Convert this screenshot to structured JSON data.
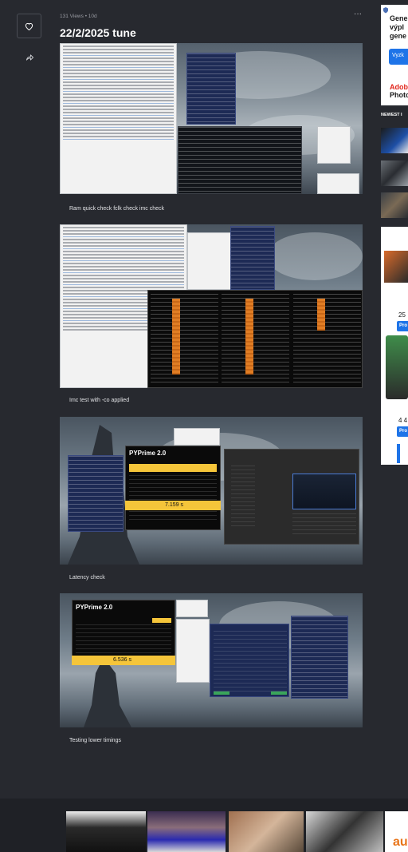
{
  "post": {
    "views": "131 Views",
    "age": "10d",
    "separator": "•",
    "title": "22/2/2025 tune",
    "more_label": "···"
  },
  "actions": {
    "favorite_icon": "heart-outline-icon",
    "share_icon": "share-arrow-icon"
  },
  "images": [
    {
      "caption": "Ram quick check fclk check imc check",
      "timer": ""
    },
    {
      "caption": "Imc test with -co applied",
      "timer": ""
    },
    {
      "caption": "Latency check",
      "timer": "7.159 s",
      "app_title": "PYPrime 2.0"
    },
    {
      "caption": "Testing lower timings",
      "timer": "6.536 s",
      "app_title": "PYPrime 2.0"
    }
  ],
  "sidebar": {
    "ad_top": {
      "lines": [
        "Gene",
        "výpl",
        "gene"
      ],
      "button": "Vyzk",
      "brand": "Adob",
      "product": "Photo"
    },
    "newest_label": "NEWEST I",
    "ad_mid": {
      "price_1": "25",
      "price_2": "4 4",
      "button": "Pro"
    }
  },
  "footer": {
    "partial_text": "au"
  },
  "colors": {
    "background": "#27292f",
    "accent_blue": "#1e74e8",
    "timer_yellow": "#f5c53a"
  }
}
